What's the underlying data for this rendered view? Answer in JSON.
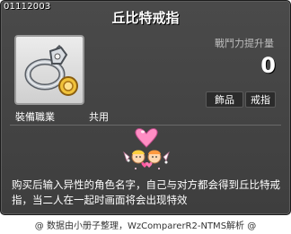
{
  "item": {
    "id": "01112003",
    "name": "丘比特戒指",
    "icon": "ring-icon",
    "attack_label": "戰鬥力提升量",
    "attack_value": "0",
    "tags": [
      "飾品",
      "戒指"
    ],
    "job_label": "裝備職業",
    "job_value": "共用",
    "effect_icon": "couple-heart-effect-icon",
    "description": "购买后输入异性的角色名字，自己与对方都会得到丘比特戒指，当二人在一起时画面将会出现特效"
  },
  "footer": {
    "credit": "@ 数据由小册子整理，WzComparerR2-NTMS解析 @"
  },
  "colors": {
    "panel_bg": "#444444",
    "text": "#ffffff",
    "muted": "#bdbdbd"
  }
}
